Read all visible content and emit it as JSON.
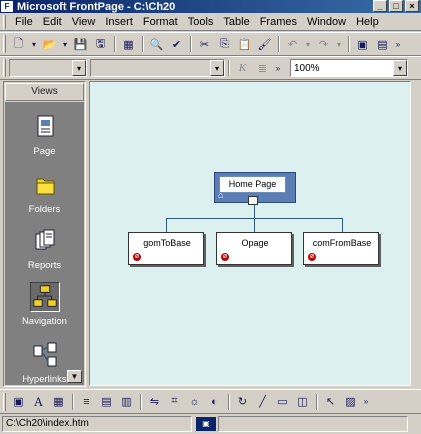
{
  "window": {
    "title": "Microsoft FrontPage - C:\\Ch20",
    "buttons": [
      "_",
      "□",
      "×"
    ]
  },
  "menubar": {
    "items": [
      "File",
      "Edit",
      "View",
      "Insert",
      "Format",
      "Tools",
      "Table",
      "Frames",
      "Window",
      "Help"
    ]
  },
  "toolbar_standard": {
    "icons": [
      "new-page-icon",
      "open-icon",
      "save-icon",
      "publish-icon",
      "folder-list-icon",
      "print-preview-icon",
      "spelling-icon",
      "cut-icon",
      "copy-icon",
      "paste-icon",
      "format-painter-icon",
      "undo-icon",
      "redo-icon",
      "insert-component-icon",
      "more-buttons-icon"
    ]
  },
  "toolbar_formatting": {
    "style_value": "",
    "font_value": "",
    "zoom_value": "100%"
  },
  "views": {
    "header": "Views",
    "items": [
      {
        "label": "Page",
        "icon": "page-view-icon"
      },
      {
        "label": "Folders",
        "icon": "folders-view-icon"
      },
      {
        "label": "Reports",
        "icon": "reports-view-icon"
      },
      {
        "label": "Navigation",
        "icon": "navigation-view-icon"
      },
      {
        "label": "Hyperlinks",
        "icon": "hyperlinks-view-icon"
      }
    ]
  },
  "navigation": {
    "home_label": "Home Page",
    "children": [
      "gomToBase",
      "Opage",
      "comFromBase"
    ]
  },
  "drawbar": {
    "icons": [
      "text-icon",
      "wordart-icon",
      "image-icon",
      "align-left-icon",
      "align-center-icon",
      "align-right-icon",
      "flip-icon",
      "crop-icon",
      "brightness-icon",
      "contrast-icon",
      "rotate-icon",
      "line-icon",
      "rectangle-icon",
      "bevel-icon",
      "select-icon",
      "hotspot-icon"
    ]
  },
  "status": {
    "path": "C:\\Ch20\\index.htm",
    "indicator": "▣"
  },
  "colors": {
    "nav_background": "#dcf0f0",
    "home_node": "#5b7fb5",
    "views_background": "#808080",
    "error_icon": "#c00000"
  }
}
